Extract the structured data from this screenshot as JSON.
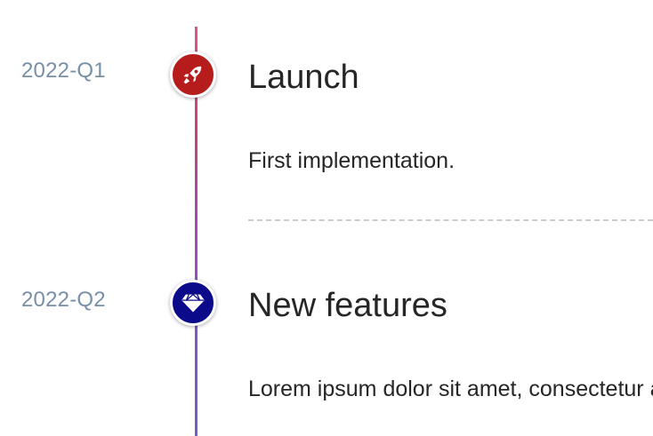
{
  "colors": {
    "launch_marker": "#b71c1c",
    "features_marker": "#0a0a8a",
    "date_text": "#7790a8",
    "body_text": "#262626",
    "divider": "#cccccc"
  },
  "events": [
    {
      "date": "2022-Q1",
      "title": "Launch",
      "description": "First implementation.",
      "icon": "rocket-icon"
    },
    {
      "date": "2022-Q2",
      "title": "New features",
      "description": "Lorem ipsum dolor sit amet, consectetur adipiscing elit.",
      "icon": "diamond-icon"
    }
  ]
}
